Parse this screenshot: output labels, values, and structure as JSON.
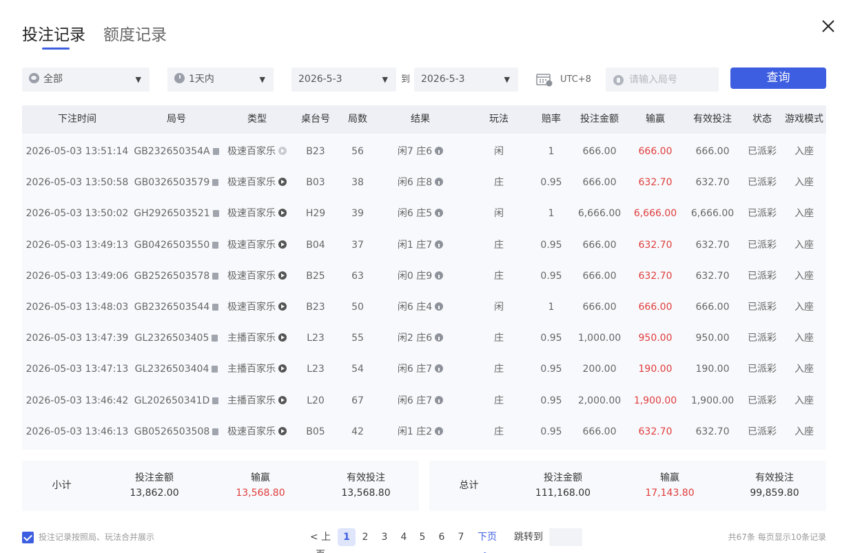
{
  "tabs": [
    {
      "label": "投注记录",
      "active": true
    },
    {
      "label": "额度记录",
      "active": false
    }
  ],
  "filters": {
    "category": "全部",
    "time_range": "1天内",
    "date_from": "2026-5-3",
    "to_label": "到",
    "date_to": "2026-5-3",
    "timezone": "UTC+8",
    "round_placeholder": "请输入局号",
    "query_label": "查询"
  },
  "table": {
    "headers": [
      "下注时间",
      "局号",
      "类型",
      "桌台号",
      "局数",
      "结果",
      "玩法",
      "赔率",
      "投注金额",
      "输赢",
      "有效投注",
      "状态",
      "游戏模式"
    ],
    "rows": [
      {
        "time": "2026-05-03 13:51:14",
        "round": "GB232650354A",
        "type": "极速百家乐",
        "play_dim": true,
        "table": "B23",
        "shoe": "56",
        "result": "闲7 庄6",
        "bet": "闲",
        "odds": "1",
        "amount": "666.00",
        "winloss": "666.00",
        "valid": "666.00",
        "status": "已派彩",
        "mode": "入座"
      },
      {
        "time": "2026-05-03 13:50:58",
        "round": "GB0326503579",
        "type": "极速百家乐",
        "play_dim": false,
        "table": "B03",
        "shoe": "38",
        "result": "闲6 庄8",
        "bet": "庄",
        "odds": "0.95",
        "amount": "666.00",
        "winloss": "632.70",
        "valid": "632.70",
        "status": "已派彩",
        "mode": "入座"
      },
      {
        "time": "2026-05-03 13:50:02",
        "round": "GH2926503521",
        "type": "极速百家乐",
        "play_dim": false,
        "table": "H29",
        "shoe": "39",
        "result": "闲6 庄5",
        "bet": "闲",
        "odds": "1",
        "amount": "6,666.00",
        "winloss": "6,666.00",
        "valid": "6,666.00",
        "status": "已派彩",
        "mode": "入座"
      },
      {
        "time": "2026-05-03 13:49:13",
        "round": "GB0426503550",
        "type": "极速百家乐",
        "play_dim": false,
        "table": "B04",
        "shoe": "37",
        "result": "闲1 庄7",
        "bet": "庄",
        "odds": "0.95",
        "amount": "666.00",
        "winloss": "632.70",
        "valid": "632.70",
        "status": "已派彩",
        "mode": "入座"
      },
      {
        "time": "2026-05-03 13:49:06",
        "round": "GB2526503578",
        "type": "极速百家乐",
        "play_dim": false,
        "table": "B25",
        "shoe": "63",
        "result": "闲0 庄9",
        "bet": "庄",
        "odds": "0.95",
        "amount": "666.00",
        "winloss": "632.70",
        "valid": "632.70",
        "status": "已派彩",
        "mode": "入座"
      },
      {
        "time": "2026-05-03 13:48:03",
        "round": "GB2326503544",
        "type": "极速百家乐",
        "play_dim": false,
        "table": "B23",
        "shoe": "50",
        "result": "闲6 庄4",
        "bet": "闲",
        "odds": "1",
        "amount": "666.00",
        "winloss": "666.00",
        "valid": "666.00",
        "status": "已派彩",
        "mode": "入座"
      },
      {
        "time": "2026-05-03 13:47:39",
        "round": "GL2326503405",
        "type": "主播百家乐",
        "play_dim": false,
        "table": "L23",
        "shoe": "55",
        "result": "闲2 庄6",
        "bet": "庄",
        "odds": "0.95",
        "amount": "1,000.00",
        "winloss": "950.00",
        "valid": "950.00",
        "status": "已派彩",
        "mode": "入座"
      },
      {
        "time": "2026-05-03 13:47:13",
        "round": "GL2326503404",
        "type": "主播百家乐",
        "play_dim": false,
        "table": "L23",
        "shoe": "54",
        "result": "闲6 庄7",
        "bet": "庄",
        "odds": "0.95",
        "amount": "200.00",
        "winloss": "190.00",
        "valid": "190.00",
        "status": "已派彩",
        "mode": "入座"
      },
      {
        "time": "2026-05-03 13:46:42",
        "round": "GL202650341D",
        "type": "主播百家乐",
        "play_dim": false,
        "table": "L20",
        "shoe": "67",
        "result": "闲6 庄7",
        "bet": "庄",
        "odds": "0.95",
        "amount": "2,000.00",
        "winloss": "1,900.00",
        "valid": "1,900.00",
        "status": "已派彩",
        "mode": "入座"
      },
      {
        "time": "2026-05-03 13:46:13",
        "round": "GB0526503508",
        "type": "极速百家乐",
        "play_dim": false,
        "table": "B05",
        "shoe": "42",
        "result": "闲1 庄2",
        "bet": "庄",
        "odds": "0.95",
        "amount": "666.00",
        "winloss": "632.70",
        "valid": "632.70",
        "status": "已派彩",
        "mode": "入座"
      }
    ]
  },
  "subtotal": {
    "label": "小计",
    "amount_label": "投注金额",
    "amount": "13,862.00",
    "winloss_label": "输赢",
    "winloss": "13,568.80",
    "valid_label": "有效投注",
    "valid": "13,568.80"
  },
  "total": {
    "label": "总计",
    "amount_label": "投注金额",
    "amount": "111,168.00",
    "winloss_label": "输赢",
    "winloss": "17,143.80",
    "valid_label": "有效投注",
    "valid": "99,859.80"
  },
  "footer": {
    "merge_label": "投注记录按照局、玩法合并展示",
    "merge_checked": true,
    "prev_label": "< 上页",
    "pages": [
      "1",
      "2",
      "3",
      "4",
      "5",
      "6",
      "7"
    ],
    "current_page": "1",
    "next_label": "下页 >",
    "jump_label": "跳转到",
    "count_info": "共67条  每页显示10条记录"
  },
  "colors": {
    "accent": "#3d5ee0",
    "win": "#e03c3c"
  }
}
